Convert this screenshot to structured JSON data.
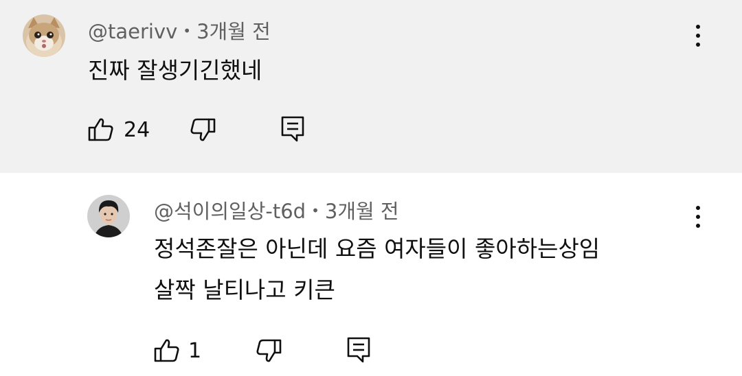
{
  "comments": [
    {
      "author": "@taerivv",
      "separator": "•",
      "time": "3개월 전",
      "text": "진짜 잘생기긴했네",
      "likes": "24"
    },
    {
      "author": "@석이의일상-t6d",
      "separator": "•",
      "time": "3개월 전",
      "text_line1": "정석존잘은 아닌데 요즘 여자들이 좋아하는상임",
      "text_line2": "살짝 날티나고 키큰",
      "likes": "1"
    }
  ],
  "icons": {
    "like": "thumb-up-icon",
    "dislike": "thumb-down-icon",
    "reply": "reply-icon",
    "more": "more-vert-icon"
  }
}
